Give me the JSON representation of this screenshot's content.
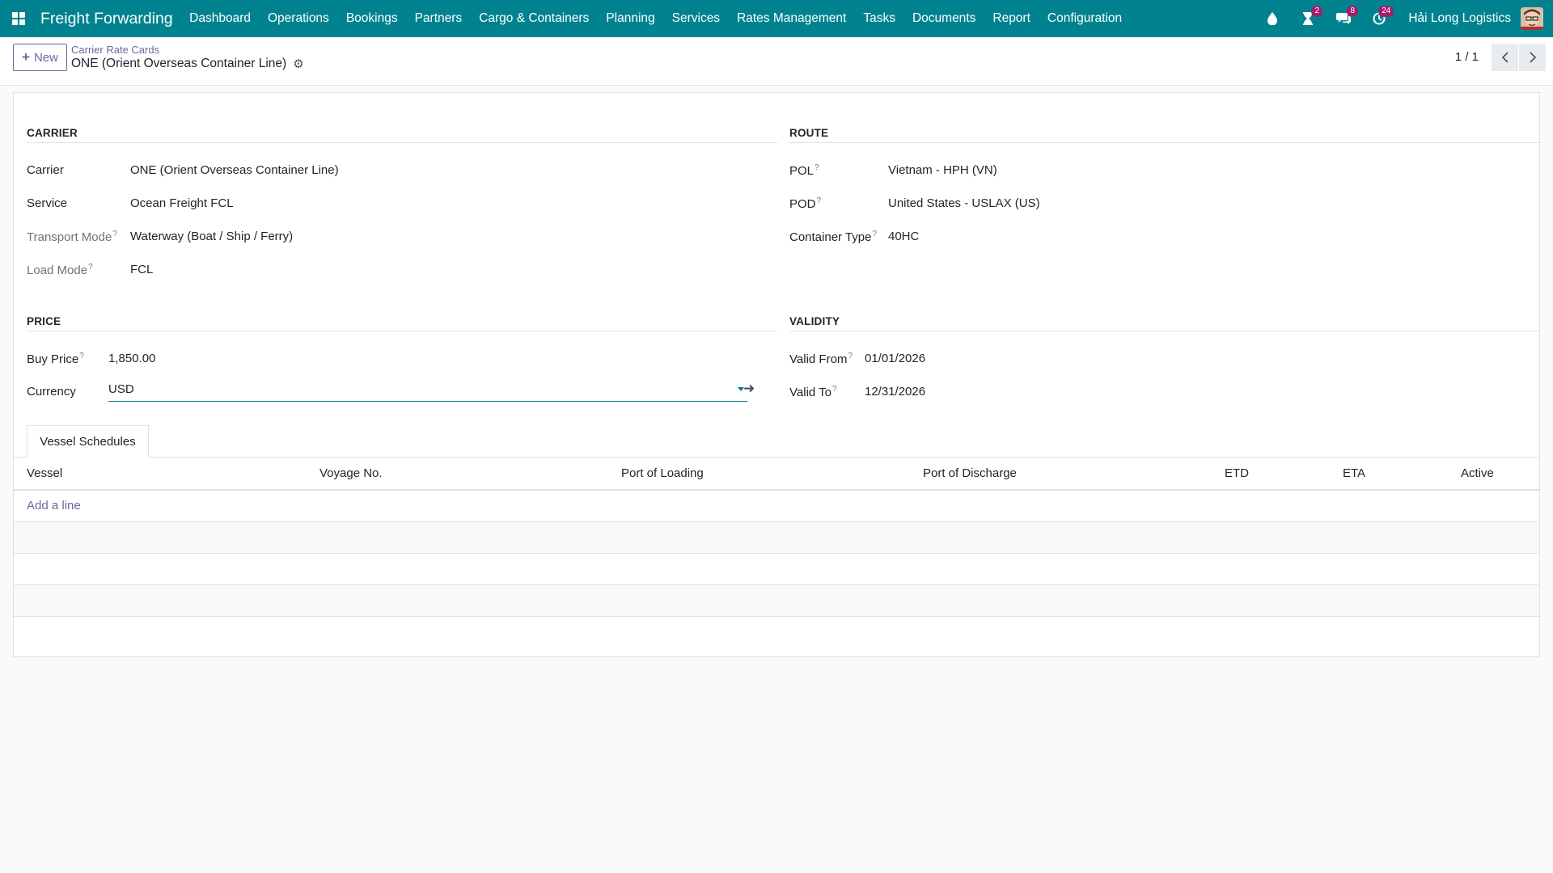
{
  "navbar": {
    "brand": "Freight Forwarding",
    "menu": [
      "Dashboard",
      "Operations",
      "Bookings",
      "Partners",
      "Cargo & Containers",
      "Planning",
      "Services",
      "Rates Management",
      "Tasks",
      "Documents",
      "Report",
      "Configuration"
    ],
    "activity_badge": "2",
    "messages_badge": "8",
    "clock_badge": "24",
    "company": "Hải Long Logistics"
  },
  "control": {
    "new_label": "New",
    "breadcrumb_parent": "Carrier Rate Cards",
    "record_title": "ONE (Orient Overseas Container Line)",
    "pager": "1 / 1"
  },
  "carrier": {
    "title": "CARRIER",
    "carrier_label": "Carrier",
    "carrier_value": "ONE (Orient Overseas Container Line)",
    "service_label": "Service",
    "service_value": "Ocean Freight FCL",
    "transport_label": "Transport Mode",
    "transport_value": "Waterway (Boat / Ship / Ferry)",
    "load_label": "Load Mode",
    "load_value": "FCL"
  },
  "route": {
    "title": "ROUTE",
    "pol_label": "POL",
    "pol_value": "Vietnam - HPH (VN)",
    "pod_label": "POD",
    "pod_value": "United States - USLAX (US)",
    "container_label": "Container Type",
    "container_value": "40HC"
  },
  "price": {
    "title": "PRICE",
    "buy_label": "Buy Price",
    "buy_value": "1,850.00",
    "currency_label": "Currency",
    "currency_value": "USD"
  },
  "validity": {
    "title": "VALIDITY",
    "from_label": "Valid From",
    "from_value": "01/01/2026",
    "to_label": "Valid To",
    "to_value": "12/31/2026"
  },
  "schedules": {
    "tab_label": "Vessel Schedules",
    "columns": [
      "Vessel",
      "Voyage No.",
      "Port of Loading",
      "Port of Discharge",
      "ETD",
      "ETA",
      "Active"
    ],
    "add_line": "Add a line"
  },
  "help_marker": "?",
  "colors": {
    "navbar": "#00838f",
    "accent": "#71639e",
    "badge": "#a21f6b"
  }
}
